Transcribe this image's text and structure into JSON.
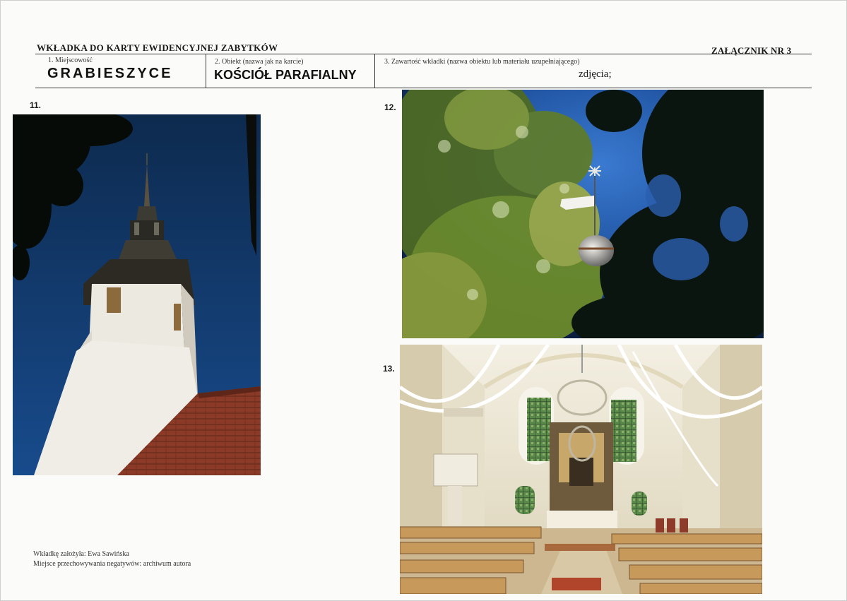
{
  "header": {
    "title": "WKŁADKA DO KARTY EWIDENCYJNEJ ZABYTKÓW",
    "attachment": "ZAŁĄCZNIK NR 3"
  },
  "fields": {
    "locality_label": "1. Miejscowość",
    "locality_value": "GRABIESZYCE",
    "object_label": "2. Obiekt (nazwa jak na karcie)",
    "object_value": "KOŚCIÓŁ PARAFIALNY",
    "content_label": "3. Zawartość wkładki (nazwa obiektu lub materiału uzupełniającego)",
    "content_value": "zdjęcia;"
  },
  "photos": [
    {
      "number": "11."
    },
    {
      "number": "12."
    },
    {
      "number": "13."
    }
  ],
  "footer": {
    "author_line": "Wkładkę założyła: Ewa Sawińska",
    "storage_line": "Miejsce przechowywania negatywów: archiwum autora"
  },
  "colors": {
    "sky_deep": "#0d2a4e",
    "sky_bright": "#2c66b8",
    "tower_white": "#ece9e0",
    "roof_tile": "#8a3a26",
    "foliage": "#6b8a2a",
    "interior_cream": "#e9e2cc",
    "pew_wood": "#c79a5c"
  }
}
